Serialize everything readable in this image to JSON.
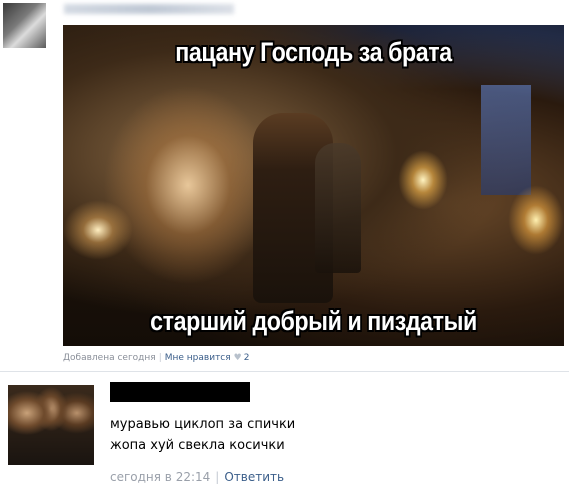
{
  "post": {
    "meme_top_text": "пацану Господь за брата",
    "meme_bottom_text": "старший добрый и пиздатый",
    "added_text": "Добавлена сегодня",
    "like_label": "Мне нравится",
    "like_count": "2"
  },
  "comment": {
    "line1": "муравью циклоп за спички",
    "line2": "жопа хуй свекла косички",
    "time": "сегодня в 22:14",
    "reply_label": "Ответить"
  }
}
